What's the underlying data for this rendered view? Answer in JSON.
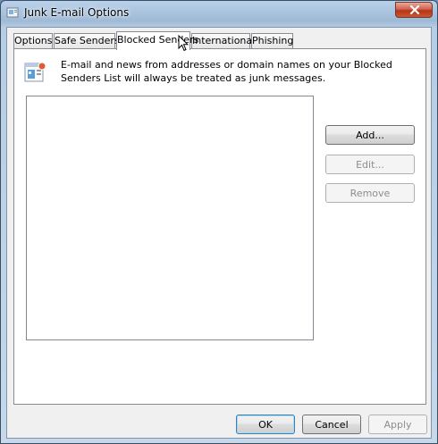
{
  "window": {
    "title": "Junk E-mail Options",
    "icons": {
      "app": "junk-mail-options-icon",
      "close": "close-icon"
    }
  },
  "tabs": [
    {
      "label": "Options",
      "active": false
    },
    {
      "label": "Safe Senders",
      "active": false
    },
    {
      "label": "Blocked Senders",
      "active": true
    },
    {
      "label": "International",
      "active": false
    },
    {
      "label": "Phishing",
      "active": false
    }
  ],
  "blocked_senders": {
    "description": "E-mail and news from addresses or domain names on your Blocked Senders List will always be treated as junk messages.",
    "icon": "blocked-senders-icon",
    "list_items": [],
    "buttons": {
      "add": {
        "label": "Add...",
        "enabled": true
      },
      "edit": {
        "label": "Edit...",
        "enabled": false
      },
      "remove": {
        "label": "Remove",
        "enabled": false
      }
    }
  },
  "footer": {
    "ok": {
      "label": "OK",
      "enabled": true
    },
    "cancel": {
      "label": "Cancel",
      "enabled": true
    },
    "apply": {
      "label": "Apply",
      "enabled": false
    }
  },
  "colors": {
    "title_bar": "#9fbad6",
    "close_button": "#c8452c",
    "panel": "#ffffff",
    "dialog_face": "#f0f0f0",
    "disabled_text": "#8d8d8d"
  }
}
